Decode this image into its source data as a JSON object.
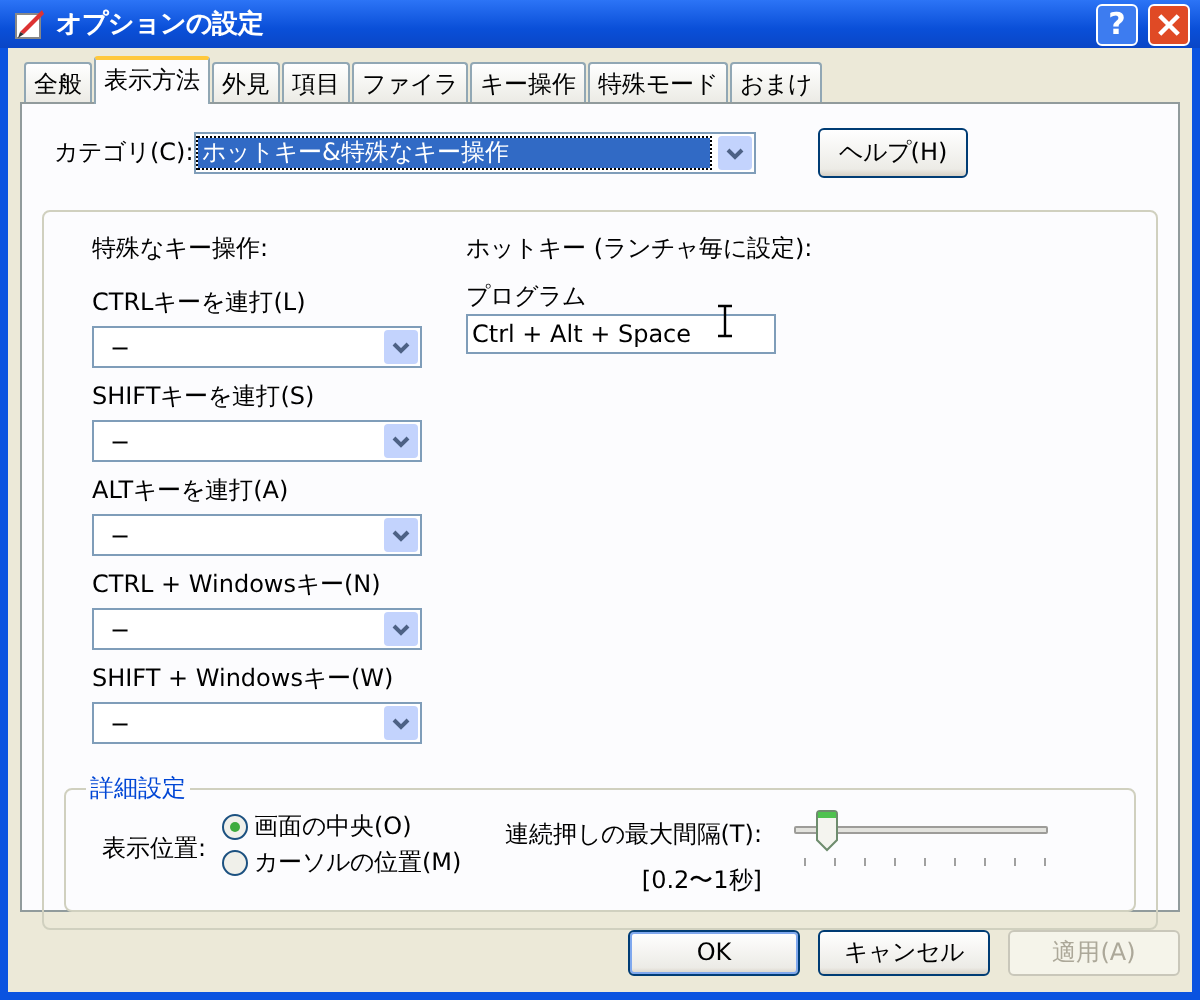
{
  "window": {
    "title": "オプションの設定",
    "help_glyph": "?"
  },
  "tabs": [
    {
      "label": "全般",
      "selected": false
    },
    {
      "label": "表示方法",
      "selected": true
    },
    {
      "label": "外見",
      "selected": false
    },
    {
      "label": "項目",
      "selected": false
    },
    {
      "label": "ファイラ",
      "selected": false
    },
    {
      "label": "キー操作",
      "selected": false
    },
    {
      "label": "特殊モード",
      "selected": false
    },
    {
      "label": "おまけ",
      "selected": false
    }
  ],
  "category": {
    "label": "カテゴリ(C):",
    "value": "ホットキー&特殊なキー操作",
    "help_button": "ヘルプ(H)"
  },
  "special_keys": {
    "heading": "特殊なキー操作:",
    "fields": [
      {
        "label": "CTRLキーを連打(L)",
        "value": "−"
      },
      {
        "label": "SHIFTキーを連打(S)",
        "value": "−"
      },
      {
        "label": "ALTキーを連打(A)",
        "value": "−"
      },
      {
        "label": "CTRL + Windowsキー(N)",
        "value": "−"
      },
      {
        "label": "SHIFT + Windowsキー(W)",
        "value": "−"
      }
    ]
  },
  "hotkey": {
    "heading": "ホットキー (ランチャ毎に設定):",
    "label": "プログラム",
    "value": "Ctrl + Alt + Space"
  },
  "details": {
    "legend": "詳細設定",
    "position_label": "表示位置:",
    "positions": [
      {
        "label": "画面の中央(O)",
        "selected": true
      },
      {
        "label": "カーソルの位置(M)",
        "selected": false
      }
    ],
    "interval_label": "連続押しの最大間隔(T):",
    "interval_range": "[0.2〜1秒]",
    "interval": {
      "level": 0.125
    }
  },
  "buttons": [
    {
      "label": "OK",
      "disabled": false,
      "default": true
    },
    {
      "label": "キャンセル",
      "disabled": false,
      "default": false
    },
    {
      "label": "適用(A)",
      "disabled": true,
      "default": false
    }
  ]
}
